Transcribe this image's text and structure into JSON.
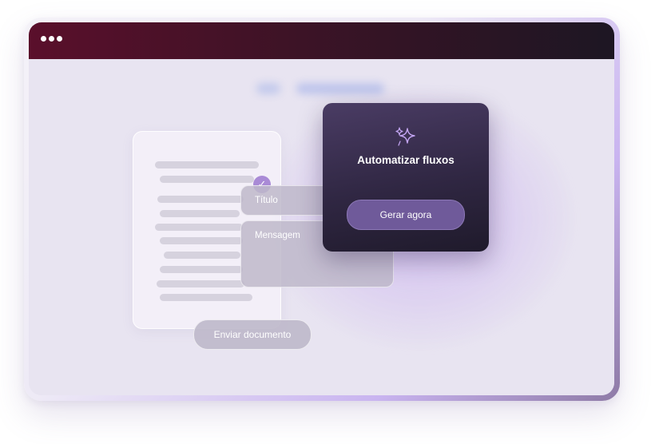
{
  "window": {
    "controls_icon": "more-dots-icon"
  },
  "document": {
    "status_icon": "check-icon"
  },
  "form": {
    "title_label": "Título",
    "message_label": "Mensagem",
    "send_button": "Enviar documento"
  },
  "card": {
    "icon": "sparkles-icon",
    "title": "Automatizar fluxos",
    "button": "Gerar agora"
  },
  "colors": {
    "titlebar_start": "#5a0f2b",
    "titlebar_end": "#1d1623",
    "accent": "#a98ad6",
    "card_button": "#6f5a9a"
  }
}
